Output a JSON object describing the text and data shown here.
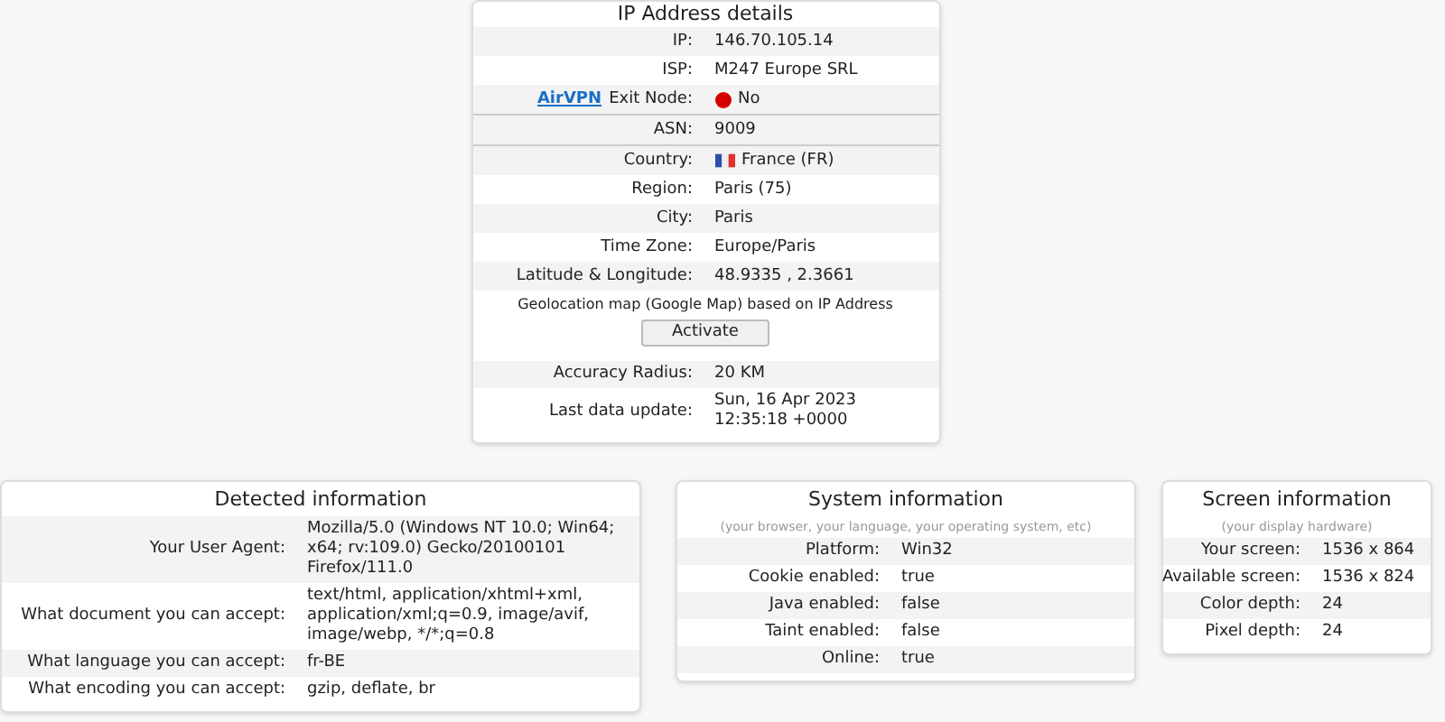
{
  "ip_panel": {
    "title": "IP Address details",
    "sections": [
      [
        {
          "label": "IP:",
          "value": "146.70.105.14"
        },
        {
          "label": "ISP:",
          "value": "M247 Europe SRL"
        },
        {
          "link": "AirVPN",
          "label": "Exit Node:",
          "value": "No",
          "color": "#d40000"
        }
      ],
      [
        {
          "label": "ASN:",
          "value": "9009"
        }
      ],
      [
        {
          "label": "Country:",
          "value": "France (FR)",
          "flag": true
        },
        {
          "label": "Region:",
          "value": "Paris (75)"
        },
        {
          "label": "City:",
          "value": "Paris"
        },
        {
          "label": "Time Zone:",
          "value": "Europe/Paris"
        },
        {
          "label": "Latitude & Longitude:",
          "value": "48.9335 , 2.3661"
        }
      ]
    ],
    "map": {
      "text": "Geolocation map (Google Map) based on IP Address",
      "button": "Activate"
    },
    "extra_rows": [
      {
        "label": "Accuracy Radius:",
        "value": "20 KM"
      },
      {
        "label": "Last data update:",
        "value": "Sun, 16 Apr 2023 12:35:18 +0000"
      }
    ]
  },
  "detected": {
    "title": "Detected information",
    "rows": [
      {
        "label": "Your User Agent:",
        "value": "Mozilla/5.0 (Windows NT 10.0; Win64; x64; rv:109.0) Gecko/20100101 Firefox/111.0"
      },
      {
        "label": "What document you can accept:",
        "value": "text/html, application/xhtml+xml, application/xml;q=0.9, image/avif, image/webp, */*;q=0.8"
      },
      {
        "label": "What language you can accept:",
        "value": "fr-BE"
      },
      {
        "label": "What encoding you can accept:",
        "value": "gzip, deflate, br"
      }
    ]
  },
  "system": {
    "title": "System information",
    "subtitle": "(your browser, your language, your operating system, etc)",
    "rows": [
      {
        "label": "Platform:",
        "value": "Win32"
      },
      {
        "label": "Cookie enabled:",
        "value": "true"
      },
      {
        "label": "Java enabled:",
        "value": "false"
      },
      {
        "label": "Taint enabled:",
        "value": "false"
      },
      {
        "label": "Online:",
        "value": "true"
      }
    ]
  },
  "screen": {
    "title": "Screen information",
    "subtitle": "(your display hardware)",
    "rows": [
      {
        "label": "Your screen:",
        "value": "1536 x 864"
      },
      {
        "label": "Available screen:",
        "value": "1536 x 824"
      },
      {
        "label": "Color depth:",
        "value": "24"
      },
      {
        "label": "Pixel depth:",
        "value": "24"
      }
    ]
  }
}
